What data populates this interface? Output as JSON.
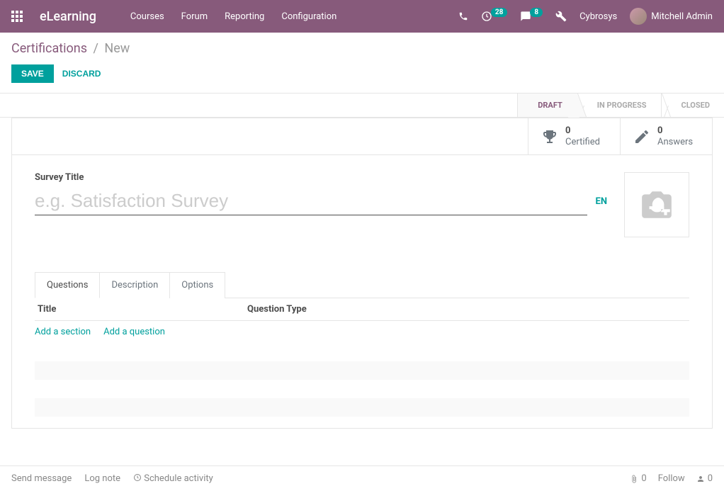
{
  "topbar": {
    "brand": "eLearning",
    "nav": [
      "Courses",
      "Forum",
      "Reporting",
      "Configuration"
    ],
    "clock_badge": "28",
    "chat_badge": "8",
    "company": "Cybrosys",
    "user": "Mitchell Admin"
  },
  "breadcrumb": {
    "parent": "Certifications",
    "current": "New"
  },
  "buttons": {
    "save": "SAVE",
    "discard": "DISCARD"
  },
  "status": {
    "draft": "DRAFT",
    "in_progress": "IN PROGRESS",
    "closed": "CLOSED"
  },
  "stats": {
    "certified": {
      "count": "0",
      "label": "Certified"
    },
    "answers": {
      "count": "0",
      "label": "Answers"
    }
  },
  "form": {
    "title_label": "Survey Title",
    "title_placeholder": "e.g. Satisfaction Survey",
    "lang": "EN"
  },
  "tabs": {
    "questions": "Questions",
    "description": "Description",
    "options": "Options"
  },
  "columns": {
    "title": "Title",
    "qtype": "Question Type"
  },
  "actions": {
    "add_section": "Add a section",
    "add_question": "Add a question"
  },
  "chatter": {
    "send_message": "Send message",
    "log_note": "Log note",
    "schedule": "Schedule activity",
    "attach_count": "0",
    "follow": "Follow",
    "follower_count": "0"
  }
}
